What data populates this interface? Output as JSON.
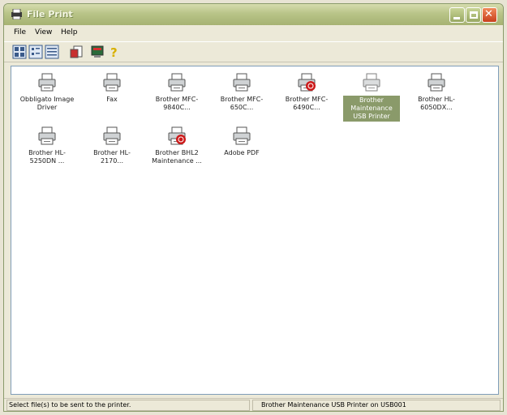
{
  "window": {
    "title": "File Print"
  },
  "menu": {
    "file": "File",
    "view": "View",
    "help": "Help"
  },
  "items": [
    {
      "label": "Obbligato Image Driver",
      "status": "normal"
    },
    {
      "label": "Fax",
      "status": "normal"
    },
    {
      "label": "Brother MFC-9840C...",
      "status": "normal"
    },
    {
      "label": "Brother MFC-650C...",
      "status": "normal"
    },
    {
      "label": "Brother MFC-6490C...",
      "status": "error"
    },
    {
      "label": "Brother Maintenance USB Printer",
      "status": "selected"
    },
    {
      "label": "Brother HL-6050DX...",
      "status": "normal"
    },
    {
      "label": "Brother HL-5250DN ...",
      "status": "normal"
    },
    {
      "label": "Brother HL-2170...",
      "status": "normal"
    },
    {
      "label": "Brother BHL2 Maintenance ...",
      "status": "error"
    },
    {
      "label": "Adobe PDF",
      "status": "normal"
    }
  ],
  "status": {
    "left": "Select file(s) to be sent to the printer.",
    "right": "Brother Maintenance USB Printer on USB001"
  },
  "colors": {
    "title_bar": "#a6b272",
    "selection": "#8a9a6a",
    "error_badge": "#cc1a1a"
  }
}
